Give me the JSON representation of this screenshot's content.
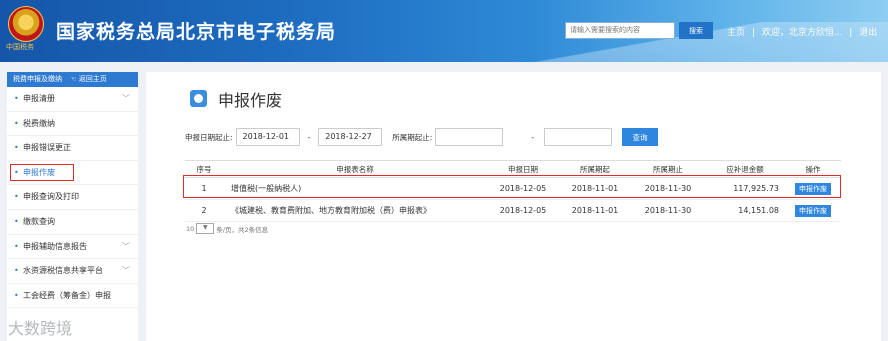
{
  "header": {
    "title": "国家税务总局北京市电子税务局",
    "emblem_text": "中国税务",
    "search_placeholder": "请输入需要搜索的内容",
    "search_button": "搜索",
    "links": [
      "主页",
      "|",
      "欢迎，北京方欣恒...",
      "|",
      "退出"
    ]
  },
  "sidebar": {
    "head": "税费申报及缴纳",
    "back_label": "返回主页",
    "items": [
      {
        "label": "申报清册",
        "chevron": "﹀"
      },
      {
        "label": "税费缴纳",
        "chevron": ""
      },
      {
        "label": "申报错误更正",
        "chevron": ""
      },
      {
        "label": "申报作废",
        "chevron": ""
      },
      {
        "label": "申报查询及打印",
        "chevron": ""
      },
      {
        "label": "缴款查询",
        "chevron": ""
      },
      {
        "label": "申报辅助信息报告",
        "chevron": "﹀"
      },
      {
        "label": "水资源税信息共享平台",
        "chevron": "﹀"
      },
      {
        "label": "工会经费（筹备金）申报",
        "chevron": ""
      }
    ]
  },
  "main": {
    "title": "申报作废",
    "filter": {
      "date_label": "申报日期起止:",
      "date_from": "2018-12-01",
      "sep": "-",
      "date_to": "2018-12-27",
      "period_label": "所属期起止:",
      "period_from": "",
      "period_sep": "-",
      "period_to": "",
      "query_button": "查询"
    },
    "table": {
      "headers": [
        "序号",
        "申报表名称",
        "申报日期",
        "所属期起",
        "所属期止",
        "应补退金额",
        "操作"
      ],
      "rows": [
        {
          "no": "1",
          "name": "增值税(一般纳税人)",
          "date": "2018-12-05",
          "start": "2018-11-01",
          "end": "2018-11-30",
          "amount": "117,925.73",
          "op": "申报作废"
        },
        {
          "no": "2",
          "name": "《城建税、教育费附加、地方教育附加税（费）申报表》",
          "date": "2018-12-05",
          "start": "2018-11-01",
          "end": "2018-11-30",
          "amount": "14,151.08",
          "op": "申报作废"
        }
      ]
    },
    "pager": {
      "page_size": "10",
      "text": "条/页，共2条信息"
    }
  },
  "watermark": "大数跨境",
  "colors": {
    "accent": "#2e86de",
    "highlight": "#e02c2c",
    "header": "#1e6ec2"
  }
}
